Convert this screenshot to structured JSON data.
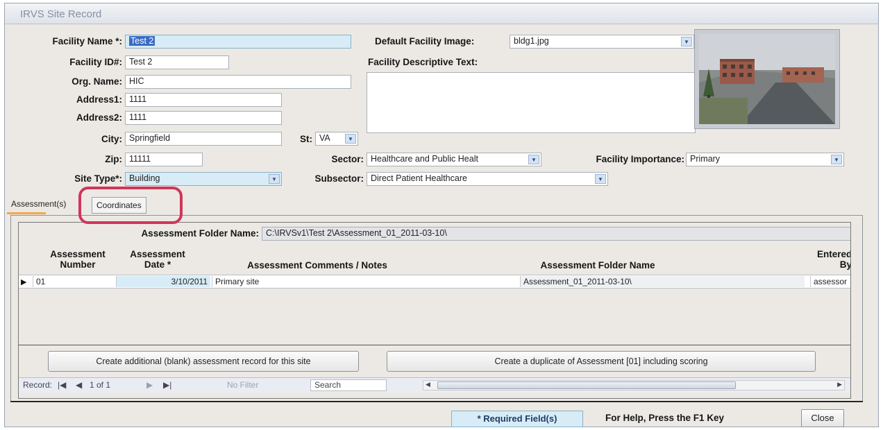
{
  "window": {
    "title": "IRVS Site Record"
  },
  "form": {
    "facility_name": {
      "label": "Facility Name *:",
      "value": "Test 2"
    },
    "facility_id": {
      "label": "Facility ID#:",
      "value": "Test 2"
    },
    "org_name": {
      "label": "Org. Name:",
      "value": "HIC"
    },
    "address1": {
      "label": "Address1:",
      "value": "1111"
    },
    "address2": {
      "label": "Address2:",
      "value": "1111"
    },
    "city": {
      "label": "City:",
      "value": "Springfield"
    },
    "state": {
      "label": "St:",
      "value": "VA"
    },
    "zip": {
      "label": "Zip:",
      "value": "11111"
    },
    "site_type": {
      "label": "Site Type*:",
      "value": "Building"
    },
    "default_image": {
      "label": "Default Facility Image:",
      "value": "bldg1.jpg"
    },
    "descriptive_text": {
      "label": "Facility Descriptive Text:",
      "value": ""
    },
    "sector": {
      "label": "Sector:",
      "value": "Healthcare and Public Healt"
    },
    "subsector": {
      "label": "Subsector:",
      "value": "Direct Patient Healthcare"
    },
    "importance": {
      "label": "Facility Importance:",
      "value": "Primary"
    }
  },
  "tabs": [
    {
      "label": "Assessment(s)"
    },
    {
      "label": "Coordinates"
    }
  ],
  "assessment": {
    "folder_label": "Assessment Folder Name:",
    "folder_value": "C:\\IRVSv1\\Test 2\\Assessment_01_2011-03-10\\",
    "columns": {
      "number": "Assessment Number",
      "date": "Assessment Date *",
      "comments": "Assessment Comments / Notes",
      "folder": "Assessment Folder Name",
      "entered_by": "Entered By"
    },
    "rows": [
      {
        "number": "01",
        "date": "3/10/2011",
        "comments": "Primary site",
        "folder": "Assessment_01_2011-03-10\\",
        "entered_by": "assessor"
      }
    ],
    "create_blank_label": "Create additional (blank) assessment record for this site",
    "create_duplicate_label": "Create a duplicate of Assessment [01] including scoring"
  },
  "navigation": {
    "record_label": "Record:",
    "first": "|◀",
    "prev": "◀",
    "position": "1 of 1",
    "next": "▶",
    "last": "▶|",
    "filter_label": "No Filter",
    "search_placeholder": "Search"
  },
  "footer": {
    "required_label": "* Required Field(s)",
    "help_text": "For Help, Press the F1 Key",
    "close_label": "Close"
  }
}
